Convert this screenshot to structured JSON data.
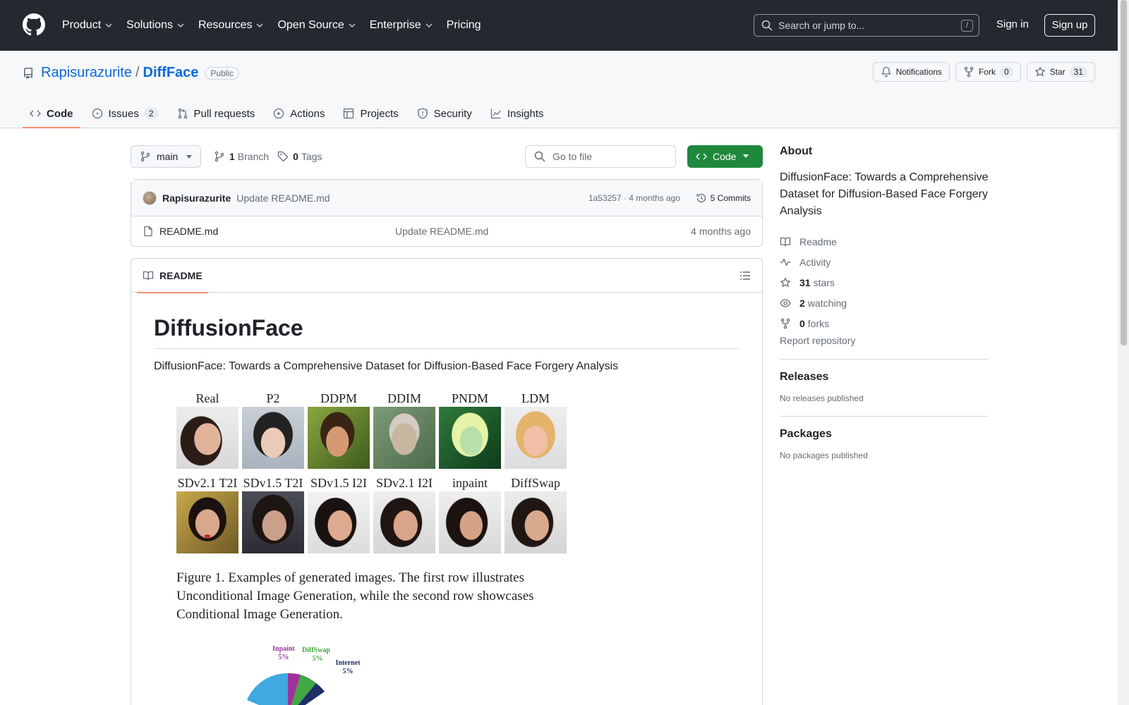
{
  "nav": {
    "items": [
      "Product",
      "Solutions",
      "Resources",
      "Open Source",
      "Enterprise",
      "Pricing"
    ],
    "search_placeholder": "Search or jump to...",
    "search_kbd": "/",
    "signin": "Sign in",
    "signup": "Sign up"
  },
  "repo": {
    "owner": "Rapisurazurite",
    "sep": "/",
    "name": "DiffFace",
    "visibility": "Public",
    "notifications": "Notifications",
    "fork": "Fork",
    "fork_count": "0",
    "star": "Star",
    "star_count": "31"
  },
  "tabs": [
    {
      "label": "Code"
    },
    {
      "label": "Issues",
      "count": "2"
    },
    {
      "label": "Pull requests"
    },
    {
      "label": "Actions"
    },
    {
      "label": "Projects"
    },
    {
      "label": "Security"
    },
    {
      "label": "Insights"
    }
  ],
  "toolbar": {
    "branch": "main",
    "branch_count": "1",
    "branch_label": "Branch",
    "tag_count": "0",
    "tag_label": "Tags",
    "goto_placeholder": "Go to file",
    "code": "Code"
  },
  "commit": {
    "author": "Rapisurazurite",
    "message": "Update README.md",
    "sha_time": "1a53257 · 4 months ago",
    "commits": "5 Commits"
  },
  "files": [
    {
      "name": "README.md",
      "message": "Update README.md",
      "age": "4 months ago"
    }
  ],
  "readme": {
    "tab": "README",
    "title": "DiffusionFace",
    "description": "DiffusionFace: Towards a Comprehensive Dataset for Diffusion-Based Face Forgery Analysis",
    "row1": [
      "Real",
      "P2",
      "DDPM",
      "DDIM",
      "PNDM",
      "LDM"
    ],
    "row2": [
      "SDv2.1 T2I",
      "SDv1.5 T2I",
      "SDv1.5 I2I",
      "SDv2.1 I2I",
      "inpaint",
      "DiffSwap"
    ],
    "caption1": "Figure 1. Examples of generated images. The first row illustrates",
    "caption2": "Unconditional Image Generation, while the second row showcases",
    "caption3": "Conditional Image Generation.",
    "pie_labels": [
      {
        "name": "Inpaint",
        "pct": "5%"
      },
      {
        "name": "DiffSwap",
        "pct": "5%"
      },
      {
        "name": "Internet",
        "pct": "5%"
      }
    ]
  },
  "sidebar": {
    "about_title": "About",
    "about": "DiffusionFace: Towards a Comprehensive Dataset for Diffusion-Based Face Forgery Analysis",
    "readme": "Readme",
    "activity": "Activity",
    "stars_n": "31",
    "stars": "stars",
    "watching_n": "2",
    "watching": "watching",
    "forks_n": "0",
    "forks": "forks",
    "report": "Report repository",
    "releases_title": "Releases",
    "releases_none": "No releases published",
    "packages_title": "Packages",
    "packages_none": "No packages published"
  },
  "colors": {
    "header_bg": "#24292f",
    "link": "#0969da",
    "primary_btn": "#1f883d",
    "tab_underline": "#fd8c73"
  }
}
